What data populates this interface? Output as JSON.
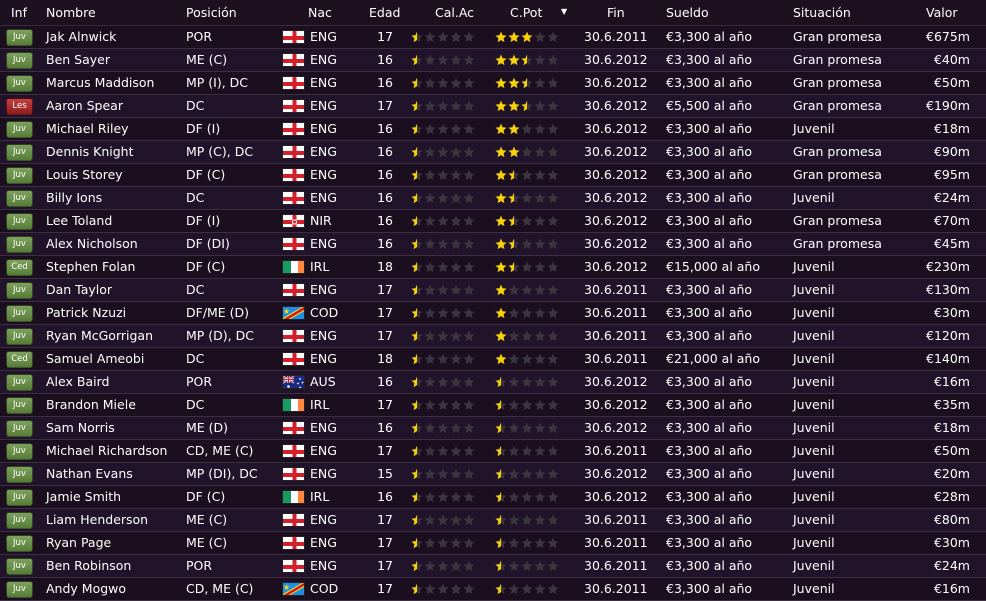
{
  "headers": {
    "inf": "Inf",
    "name": "Nombre",
    "pos": "Posición",
    "nat": "Nac",
    "age": "Edad",
    "cur": "Cal.Ac",
    "pot": "C.Pot",
    "end": "Fin",
    "wage": "Sueldo",
    "status": "Situación",
    "value": "Valor"
  },
  "rows": [
    {
      "inf": "Juv",
      "name": "Jak Alnwick",
      "pos": "POR",
      "nat": "ENG",
      "age": "17",
      "cur": 0.5,
      "pot": 3,
      "end": "30.6.2011",
      "wage": "€3,300 al año",
      "status": "Gran promesa",
      "value": "€675m"
    },
    {
      "inf": "Juv",
      "name": "Ben Sayer",
      "pos": "ME (C)",
      "nat": "ENG",
      "age": "16",
      "cur": 0.5,
      "pot": 2.5,
      "end": "30.6.2012",
      "wage": "€3,300 al año",
      "status": "Gran promesa",
      "value": "€40m"
    },
    {
      "inf": "Juv",
      "name": "Marcus Maddison",
      "pos": "MP (I), DC",
      "nat": "ENG",
      "age": "16",
      "cur": 0.5,
      "pot": 2.5,
      "end": "30.6.2012",
      "wage": "€3,300 al año",
      "status": "Gran promesa",
      "value": "€50m"
    },
    {
      "inf": "Les",
      "name": "Aaron Spear",
      "pos": "DC",
      "nat": "ENG",
      "age": "17",
      "cur": 0.5,
      "pot": 2.5,
      "end": "30.6.2012",
      "wage": "€5,500 al año",
      "status": "Gran promesa",
      "value": "€190m"
    },
    {
      "inf": "Juv",
      "name": "Michael Riley",
      "pos": "DF (I)",
      "nat": "ENG",
      "age": "16",
      "cur": 0.5,
      "pot": 2,
      "end": "30.6.2012",
      "wage": "€3,300 al año",
      "status": "Juvenil",
      "value": "€18m"
    },
    {
      "inf": "Juv",
      "name": "Dennis Knight",
      "pos": "MP (C), DC",
      "nat": "ENG",
      "age": "16",
      "cur": 0.5,
      "pot": 2,
      "end": "30.6.2012",
      "wage": "€3,300 al año",
      "status": "Gran promesa",
      "value": "€90m"
    },
    {
      "inf": "Juv",
      "name": "Louis Storey",
      "pos": "DF (C)",
      "nat": "ENG",
      "age": "16",
      "cur": 0.5,
      "pot": 1.5,
      "end": "30.6.2012",
      "wage": "€3,300 al año",
      "status": "Gran promesa",
      "value": "€95m"
    },
    {
      "inf": "Juv",
      "name": "Billy Ions",
      "pos": "DC",
      "nat": "ENG",
      "age": "16",
      "cur": 0.5,
      "pot": 1.5,
      "end": "30.6.2012",
      "wage": "€3,300 al año",
      "status": "Juvenil",
      "value": "€24m"
    },
    {
      "inf": "Juv",
      "name": "Lee Toland",
      "pos": "DF (I)",
      "nat": "NIR",
      "age": "16",
      "cur": 0.5,
      "pot": 1.5,
      "end": "30.6.2012",
      "wage": "€3,300 al año",
      "status": "Gran promesa",
      "value": "€70m"
    },
    {
      "inf": "Juv",
      "name": "Alex Nicholson",
      "pos": "DF (DI)",
      "nat": "ENG",
      "age": "16",
      "cur": 0.5,
      "pot": 1.5,
      "end": "30.6.2012",
      "wage": "€3,300 al año",
      "status": "Gran promesa",
      "value": "€45m"
    },
    {
      "inf": "Ced",
      "name": "Stephen Folan",
      "pos": "DF (C)",
      "nat": "IRL",
      "age": "18",
      "cur": 0.5,
      "pot": 1.5,
      "end": "30.6.2012",
      "wage": "€15,000 al año",
      "status": "Juvenil",
      "value": "€230m"
    },
    {
      "inf": "Juv",
      "name": "Dan Taylor",
      "pos": "DC",
      "nat": "ENG",
      "age": "17",
      "cur": 0.5,
      "pot": 1,
      "end": "30.6.2011",
      "wage": "€3,300 al año",
      "status": "Juvenil",
      "value": "€130m"
    },
    {
      "inf": "Juv",
      "name": "Patrick Nzuzi",
      "pos": "DF/ME (D)",
      "nat": "COD",
      "age": "17",
      "cur": 0.5,
      "pot": 1,
      "end": "30.6.2011",
      "wage": "€3,300 al año",
      "status": "Juvenil",
      "value": "€30m"
    },
    {
      "inf": "Juv",
      "name": "Ryan McGorrigan",
      "pos": "MP (D), DC",
      "nat": "ENG",
      "age": "17",
      "cur": 0.5,
      "pot": 1,
      "end": "30.6.2011",
      "wage": "€3,300 al año",
      "status": "Juvenil",
      "value": "€120m"
    },
    {
      "inf": "Ced",
      "name": "Samuel Ameobi",
      "pos": "DC",
      "nat": "ENG",
      "age": "18",
      "cur": 0.5,
      "pot": 1,
      "end": "30.6.2011",
      "wage": "€21,000 al año",
      "status": "Juvenil",
      "value": "€140m"
    },
    {
      "inf": "Juv",
      "name": "Alex Baird",
      "pos": "POR",
      "nat": "AUS",
      "age": "16",
      "cur": 0.5,
      "pot": 0.5,
      "end": "30.6.2012",
      "wage": "€3,300 al año",
      "status": "Juvenil",
      "value": "€16m"
    },
    {
      "inf": "Juv",
      "name": "Brandon Miele",
      "pos": "DC",
      "nat": "IRL",
      "age": "17",
      "cur": 0.5,
      "pot": 0.5,
      "end": "30.6.2012",
      "wage": "€3,300 al año",
      "status": "Juvenil",
      "value": "€35m"
    },
    {
      "inf": "Juv",
      "name": "Sam Norris",
      "pos": "ME (D)",
      "nat": "ENG",
      "age": "16",
      "cur": 0.5,
      "pot": 0.5,
      "end": "30.6.2012",
      "wage": "€3,300 al año",
      "status": "Juvenil",
      "value": "€18m"
    },
    {
      "inf": "Juv",
      "name": "Michael Richardson",
      "pos": "CD, ME (C)",
      "nat": "ENG",
      "age": "17",
      "cur": 0.5,
      "pot": 0.5,
      "end": "30.6.2011",
      "wage": "€3,300 al año",
      "status": "Juvenil",
      "value": "€50m"
    },
    {
      "inf": "Juv",
      "name": "Nathan Evans",
      "pos": "MP (DI), DC",
      "nat": "ENG",
      "age": "15",
      "cur": 0.5,
      "pot": 0.5,
      "end": "30.6.2012",
      "wage": "€3,300 al año",
      "status": "Juvenil",
      "value": "€20m"
    },
    {
      "inf": "Juv",
      "name": "Jamie Smith",
      "pos": "DF (C)",
      "nat": "IRL",
      "age": "16",
      "cur": 0.5,
      "pot": 0.5,
      "end": "30.6.2012",
      "wage": "€3,300 al año",
      "status": "Juvenil",
      "value": "€28m"
    },
    {
      "inf": "Juv",
      "name": "Liam Henderson",
      "pos": "ME (C)",
      "nat": "ENG",
      "age": "17",
      "cur": 0.5,
      "pot": 0.5,
      "end": "30.6.2011",
      "wage": "€3,300 al año",
      "status": "Juvenil",
      "value": "€80m"
    },
    {
      "inf": "Juv",
      "name": "Ryan Page",
      "pos": "ME (C)",
      "nat": "ENG",
      "age": "17",
      "cur": 0.5,
      "pot": 0.5,
      "end": "30.6.2011",
      "wage": "€3,300 al año",
      "status": "Juvenil",
      "value": "€30m"
    },
    {
      "inf": "Juv",
      "name": "Ben Robinson",
      "pos": "POR",
      "nat": "ENG",
      "age": "17",
      "cur": 0.5,
      "pot": 0.5,
      "end": "30.6.2011",
      "wage": "€3,300 al año",
      "status": "Juvenil",
      "value": "€24m"
    },
    {
      "inf": "Juv",
      "name": "Andy Mogwo",
      "pos": "CD, ME (C)",
      "nat": "COD",
      "age": "17",
      "cur": 0.5,
      "pot": 0.5,
      "end": "30.6.2011",
      "wage": "€3,300 al año",
      "status": "Juvenil",
      "value": "€16m"
    }
  ],
  "colors": {
    "background": "#1a0d1d",
    "row_alt": "#21132a",
    "star_full": "#f5d20a",
    "star_empty": "#3b3540",
    "badge_green": "#6a9248",
    "badge_red": "#b53232"
  },
  "icons": {
    "sort": "triangle-down-icon",
    "rating": "star-icon"
  }
}
